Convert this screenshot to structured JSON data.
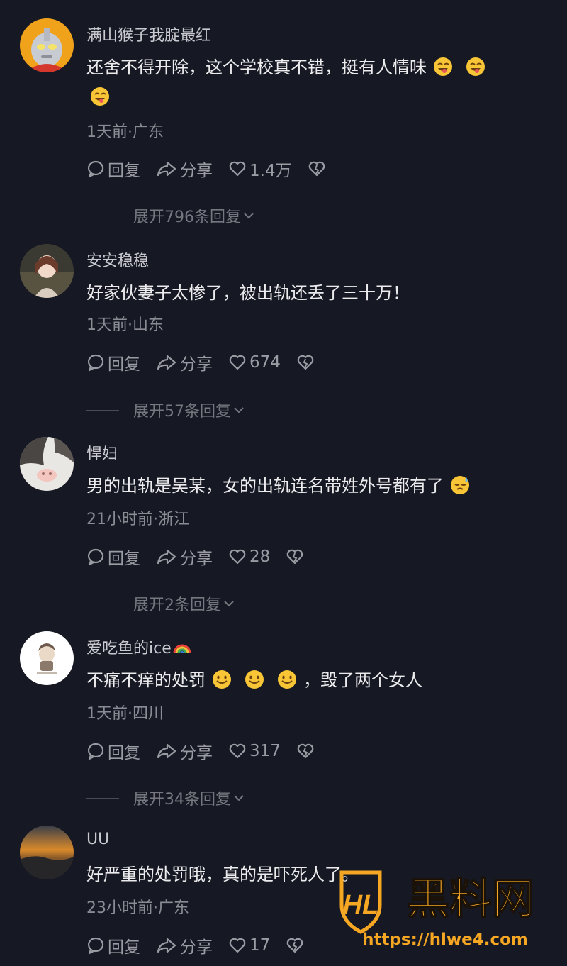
{
  "comments": [
    {
      "username": "满山猴子我腚最红",
      "text": "还舍不得开除，这个学校真不错，挺有人情味",
      "meta": "1天前·广东",
      "reply_label": "回复",
      "share_label": "分享",
      "likes": "1.4万",
      "expand": "展开796条回复",
      "avatar_icon": "ultraman-avatar",
      "emoji_icon": "grinning-tongue-emoji"
    },
    {
      "username": "安安稳稳",
      "text": "好家伙妻子太惨了，被出轨还丢了三十万！",
      "meta": "1天前·山东",
      "reply_label": "回复",
      "share_label": "分享",
      "likes": "674",
      "expand": "展开57条回复",
      "avatar_icon": "photo-avatar"
    },
    {
      "username": "悍妇",
      "text": "男的出轨是吴某，女的出轨连名带姓外号都有了",
      "meta": "21小时前·浙江",
      "reply_label": "回复",
      "share_label": "分享",
      "likes": "28",
      "expand": "展开2条回复",
      "avatar_icon": "guinea-pig-avatar",
      "emoji_icon": "sweat-emoji"
    },
    {
      "username": "爱吃鱼的ice",
      "text_before": "不痛不痒的处罚",
      "text_after": "，毁了两个女人",
      "meta": "1天前·四川",
      "reply_label": "回复",
      "share_label": "分享",
      "likes": "317",
      "expand": "展开34条回复",
      "avatar_icon": "cartoon-avatar",
      "emoji_icon": "smile-emoji"
    },
    {
      "username": "UU",
      "text": "好严重的处罚哦，真的是吓死人了。",
      "meta": "23小时前·广东",
      "reply_label": "回复",
      "share_label": "分享",
      "likes": "17",
      "avatar_icon": "sunset-avatar"
    }
  ],
  "watermark": {
    "logo_letters": "HL",
    "title": "黑料网",
    "url": "https://hlwe4.com"
  },
  "colors": {
    "background": "#161823",
    "watermark": "#f5a623"
  }
}
